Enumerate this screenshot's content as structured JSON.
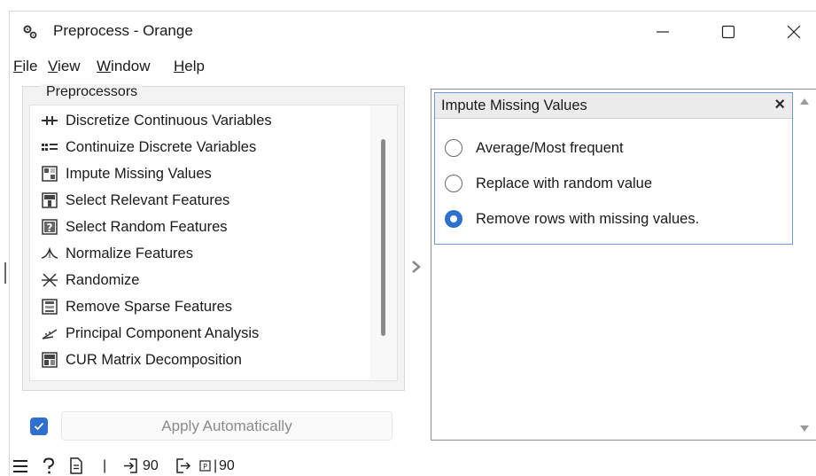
{
  "window": {
    "title": "Preprocess - Orange",
    "icon": "orange-preprocess-icon",
    "controls": [
      "minimize-icon",
      "maximize-icon",
      "close-icon"
    ]
  },
  "menu": [
    {
      "mnemonic": "F",
      "rest": "ile"
    },
    {
      "mnemonic": "V",
      "rest": "iew"
    },
    {
      "mnemonic": "W",
      "rest": "indow"
    },
    {
      "mnemonic": "H",
      "rest": "elp"
    }
  ],
  "preprocessors": {
    "title": "Preprocessors",
    "items": [
      {
        "label": "Discretize Continuous Variables",
        "icon": "discretize-icon"
      },
      {
        "label": "Continuize Discrete Variables",
        "icon": "continuize-icon"
      },
      {
        "label": "Impute Missing Values",
        "icon": "impute-icon"
      },
      {
        "label": "Select Relevant Features",
        "icon": "select-features-icon"
      },
      {
        "label": "Select Random Features",
        "icon": "random-features-icon"
      },
      {
        "label": "Normalize Features",
        "icon": "normalize-icon"
      },
      {
        "label": "Randomize",
        "icon": "randomize-icon"
      },
      {
        "label": "Remove Sparse Features",
        "icon": "sparse-icon"
      },
      {
        "label": "Principal Component Analysis",
        "icon": "pca-icon"
      },
      {
        "label": "CUR Matrix Decomposition",
        "icon": "cur-icon"
      }
    ]
  },
  "apply": {
    "checked": true,
    "label": "Apply Automatically"
  },
  "statusbar": {
    "input_count": "90",
    "output_count": "90",
    "separator": "|"
  },
  "editor": {
    "title": "Impute Missing Values",
    "close": "×",
    "options": [
      {
        "label": "Average/Most frequent",
        "checked": false
      },
      {
        "label": "Replace with random value",
        "checked": false
      },
      {
        "label": "Remove rows with missing values.",
        "checked": true
      }
    ]
  },
  "colors": {
    "accent": "#2f6fce",
    "editor_border": "#6c9ad3",
    "panel_bg": "#f3f3f3"
  }
}
